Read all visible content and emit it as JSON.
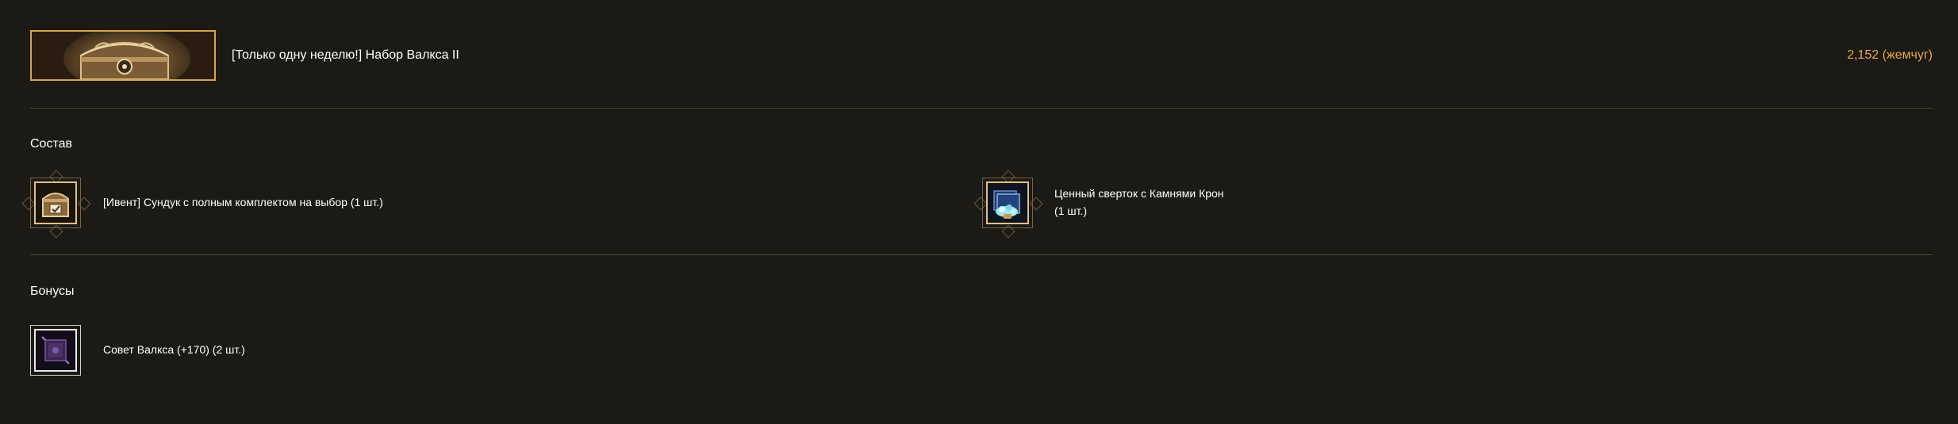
{
  "header": {
    "banner_icon": "treasure-chest-banner",
    "title": "[Только одну неделю!] Набор Валкса II",
    "price": "2,152 (жемчуг)"
  },
  "composition": {
    "title": "Состав",
    "items": [
      {
        "icon": "event-chest-icon",
        "label": "[Ивент] Сундук с полным комплектом на выбор (1 шт.)"
      },
      {
        "icon": "crown-stones-bundle-icon",
        "label_line1": "Ценный сверток с Камнями Крон",
        "label_line2": "(1 шт.)"
      }
    ]
  },
  "bonuses": {
    "title": "Бонусы",
    "items": [
      {
        "icon": "valks-scroll-icon",
        "label": "Совет Валкса (+170) (2 шт.)"
      }
    ]
  },
  "colors": {
    "background": "#1b1a14",
    "price": "#e8a94c",
    "banner_border": "#d4a64d",
    "divider": "#4a4a40"
  }
}
